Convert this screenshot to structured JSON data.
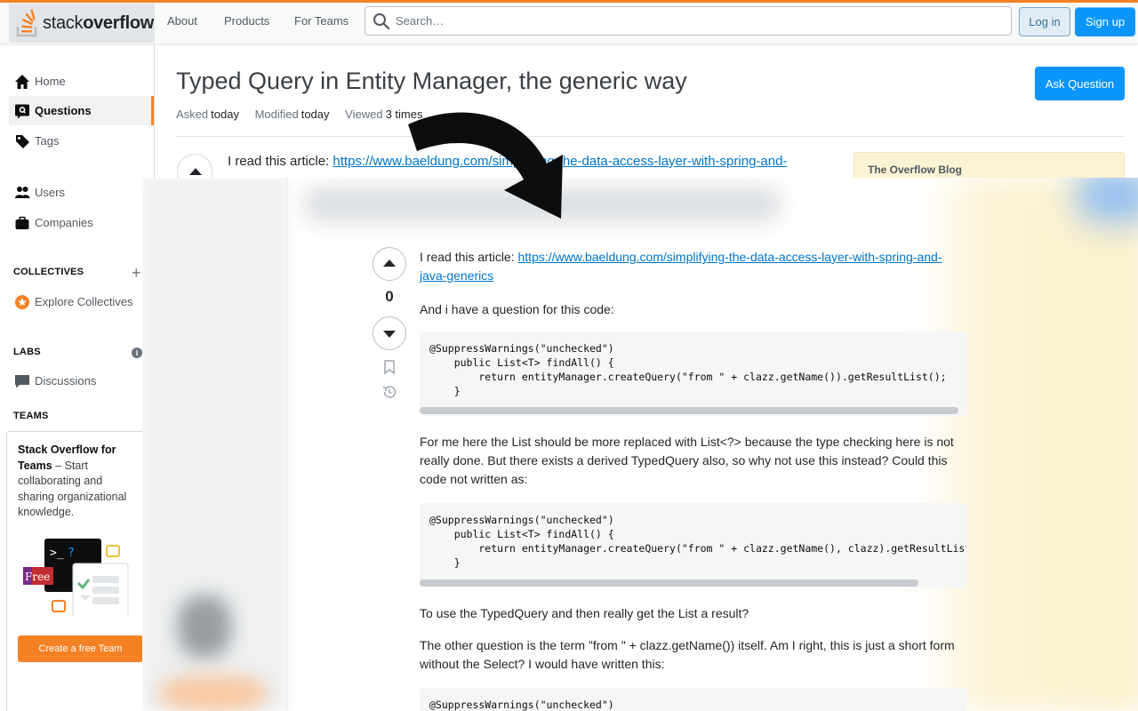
{
  "header": {
    "logo_text_light": "stack",
    "logo_text_bold": "overflow",
    "nav": [
      "About",
      "Products",
      "For Teams"
    ],
    "search_placeholder": "Search…",
    "login": "Log in",
    "signup": "Sign up",
    "accent": "#f48225",
    "primary": "#0a95ff"
  },
  "sidebar": {
    "items": [
      {
        "label": "Home",
        "icon": "home-icon"
      },
      {
        "label": "Questions",
        "icon": "questions-icon"
      },
      {
        "label": "Tags",
        "icon": "tag-icon"
      },
      {
        "label": "Users",
        "icon": "users-icon"
      },
      {
        "label": "Companies",
        "icon": "briefcase-icon"
      }
    ],
    "collectives_heading": "COLLECTIVES",
    "explore_collectives": "Explore Collectives",
    "labs_heading": "LABS",
    "discussions": "Discussions",
    "teams_heading": "TEAMS",
    "teams_card": {
      "title": "Stack Overflow for Teams",
      "desc": " – Start collaborating and sharing organizational knowledge.",
      "badge": "Free",
      "cta": "Create a free Team"
    }
  },
  "question": {
    "title": "Typed Query in Entity Manager, the generic way",
    "asked_label": "Asked",
    "asked_value": "today",
    "modified_label": "Modified",
    "modified_value": "today",
    "viewed_label": "Viewed",
    "viewed_value": "3 times",
    "ask_button": "Ask Question",
    "blog_title": "The Overflow Blog",
    "body_intro": "I read this article: ",
    "link_line1": "https://www.baeldung.com/simplifying-the-data-access-layer-with-spring-and-",
    "link_line2": "java-generics",
    "bg_link": "https://www.baeldung.com/simplifying-the-data-access-layer-with-spring-and-",
    "votes": "0",
    "p2": "And i have a question for this code:",
    "code1": "@SuppressWarnings(\"unchecked\")\n    public List<T> findAll() {\n        return entityManager.createQuery(\"from \" + clazz.getName()).getResultList();\n    }",
    "p3": "For me here the List should be more replaced with List<?> because the type checking here is not really done. But there exists a derived TypedQuery also, so why not use this instead? Could this code not written as:",
    "code2": "@SuppressWarnings(\"unchecked\")\n    public List<T> findAll() {\n        return entityManager.createQuery(\"from \" + clazz.getName(), clazz).getResultList();\n    }",
    "p4": "To use the TypedQuery and then really get the List a result?",
    "p5": "The other question is the term \"from \" + clazz.getName()) itself. Am I right, this is just a short form without the Select? I would have written this:",
    "code3": "@SuppressWarnings(\"unchecked\")"
  }
}
